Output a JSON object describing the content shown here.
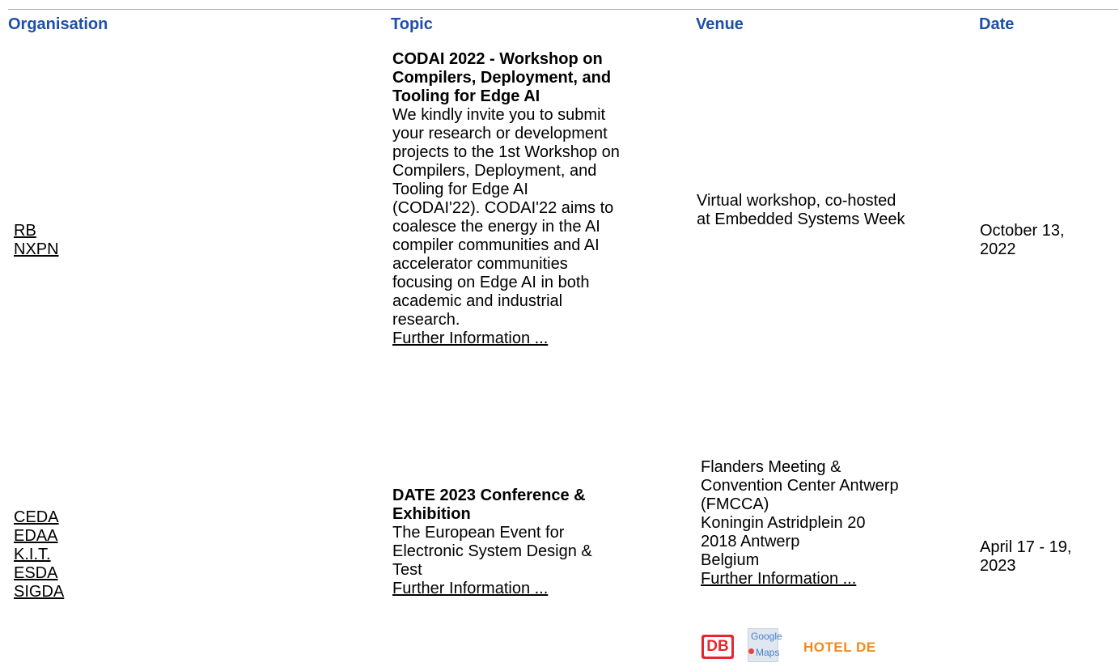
{
  "headers": {
    "organisation": "Organisation",
    "topic": "Topic",
    "venue": "Venue",
    "date": "Date"
  },
  "rows": [
    {
      "organisations": [
        "RB",
        "NXPN"
      ],
      "topic_title_lines": [
        "CODAI 2022 - Workshop on",
        "Compilers, Deployment, and",
        "Tooling for Edge AI"
      ],
      "topic_desc_lines": [
        "We kindly invite you to submit",
        "your research or development",
        "projects to the 1st Workshop on",
        "Compilers, Deployment, and",
        "Tooling for Edge AI",
        "(CODAI'22). CODAI'22 aims to",
        "coalesce the energy in the AI",
        "compiler communities and AI",
        "accelerator communities",
        "focusing on Edge AI in both",
        "academic and industrial",
        "research."
      ],
      "further_info": "Further Information ...",
      "venue_lines": [
        "Virtual workshop, co-hosted",
        "at Embedded Systems Week"
      ],
      "date_lines": [
        "October 13,",
        "2022"
      ]
    },
    {
      "organisations": [
        "CEDA",
        "EDAA",
        "K.I.T.",
        "ESDA",
        "SIGDA"
      ],
      "topic_title_lines": [
        "DATE 2023 Conference &",
        "Exhibition"
      ],
      "topic_desc_lines": [
        "The European Event for",
        "Electronic System Design &",
        "Test"
      ],
      "further_info": "Further Information ...",
      "venue_lines": [
        "Flanders Meeting &",
        "Convention Center Antwerp",
        "(FMCCA)",
        "Koningin Astridplein 20",
        "2018 Antwerp",
        "Belgium"
      ],
      "venue_further_info": "Further Information ...",
      "date_lines": [
        "April 17 - 19,",
        "2023"
      ]
    }
  ],
  "venue_icons": {
    "db": {
      "label": "DB",
      "icon": "db-logo-icon",
      "color": "#e8262e"
    },
    "google_maps": {
      "line1": "Google",
      "line2": "Maps",
      "icon": "google-maps-icon"
    },
    "hotel_de": {
      "label": "HOTEL DE",
      "icon": "hotel-de-logo-icon",
      "color": "#f08a1b"
    }
  },
  "colors": {
    "header": "#1f4fa8",
    "divider": "#a8a8a8"
  }
}
